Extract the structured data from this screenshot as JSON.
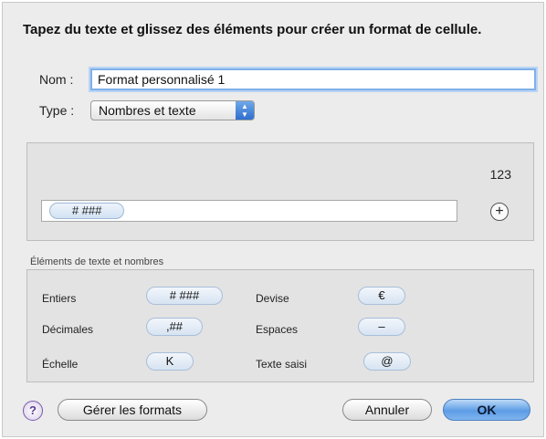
{
  "dialog": {
    "heading": "Tapez du texte et glissez des éléments pour créer un format de cellule."
  },
  "name_field": {
    "label": "Nom :",
    "value": "Format personnalisé 1"
  },
  "type_field": {
    "label": "Type :",
    "value": "Nombres et texte",
    "icon": "updown-arrows-icon"
  },
  "preview": {
    "sample_value": "123",
    "format_tokens": [
      "# ###"
    ],
    "add_button_icon": "plus-circle-icon",
    "add_button_glyph": "+"
  },
  "elements": {
    "title": "Éléments de texte et nombres",
    "items": [
      {
        "label": "Entiers",
        "token": "# ###"
      },
      {
        "label": "Décimales",
        "token": ",##"
      },
      {
        "label": "Échelle",
        "token": "K"
      },
      {
        "label": "Devise",
        "token": "€"
      },
      {
        "label": "Espaces",
        "token": "–"
      },
      {
        "label": "Texte saisi",
        "token": "@"
      }
    ]
  },
  "footer": {
    "help_glyph": "?",
    "manage_label": "Gérer les formats",
    "cancel_label": "Annuler",
    "ok_label": "OK"
  },
  "colors": {
    "focus_ring": "#7fb0e8",
    "default_button": "#5d9de6",
    "sheet_background": "#ececec"
  }
}
